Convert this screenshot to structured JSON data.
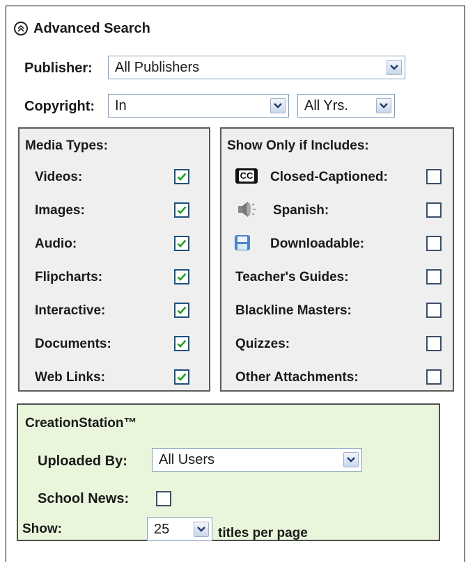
{
  "advanced_search": {
    "title": "Advanced Search"
  },
  "publisher": {
    "label": "Publisher:",
    "value": "All Publishers"
  },
  "copyright": {
    "label": "Copyright:",
    "mode_value": "In",
    "years_value": "All Yrs."
  },
  "media_types": {
    "heading": "Media Types:",
    "items": [
      {
        "label": "Videos:",
        "checked": true
      },
      {
        "label": "Images:",
        "checked": true
      },
      {
        "label": "Audio:",
        "checked": true
      },
      {
        "label": "Flipcharts:",
        "checked": true
      },
      {
        "label": "Interactive:",
        "checked": true
      },
      {
        "label": "Documents:",
        "checked": true
      },
      {
        "label": "Web Links:",
        "checked": true
      }
    ]
  },
  "includes": {
    "heading": "Show Only if Includes:",
    "items": [
      {
        "label": "Closed-Captioned:",
        "icon": "closed-caption-icon",
        "checked": false
      },
      {
        "label": "Spanish:",
        "icon": "speaker-icon",
        "checked": false
      },
      {
        "label": "Downloadable:",
        "icon": "floppy-disk-icon",
        "checked": false
      },
      {
        "label": "Teacher's Guides:",
        "checked": false
      },
      {
        "label": "Blackline Masters:",
        "checked": false
      },
      {
        "label": "Quizzes:",
        "checked": false
      },
      {
        "label": "Other Attachments:",
        "checked": false
      }
    ],
    "cc_icon_text": "CC"
  },
  "creation_station": {
    "heading": "CreationStation™",
    "uploaded_by_label": "Uploaded By:",
    "uploaded_by_value": "All Users",
    "school_news_label": "School News:",
    "school_news_checked": false
  },
  "show": {
    "label": "Show:",
    "value": "25",
    "suffix": "titles per page"
  },
  "colors": {
    "panel_bg": "#efefef",
    "creation_bg": "#eaf6dc",
    "checkbox_border": "#1c5180",
    "check_mark": "#21a121"
  }
}
